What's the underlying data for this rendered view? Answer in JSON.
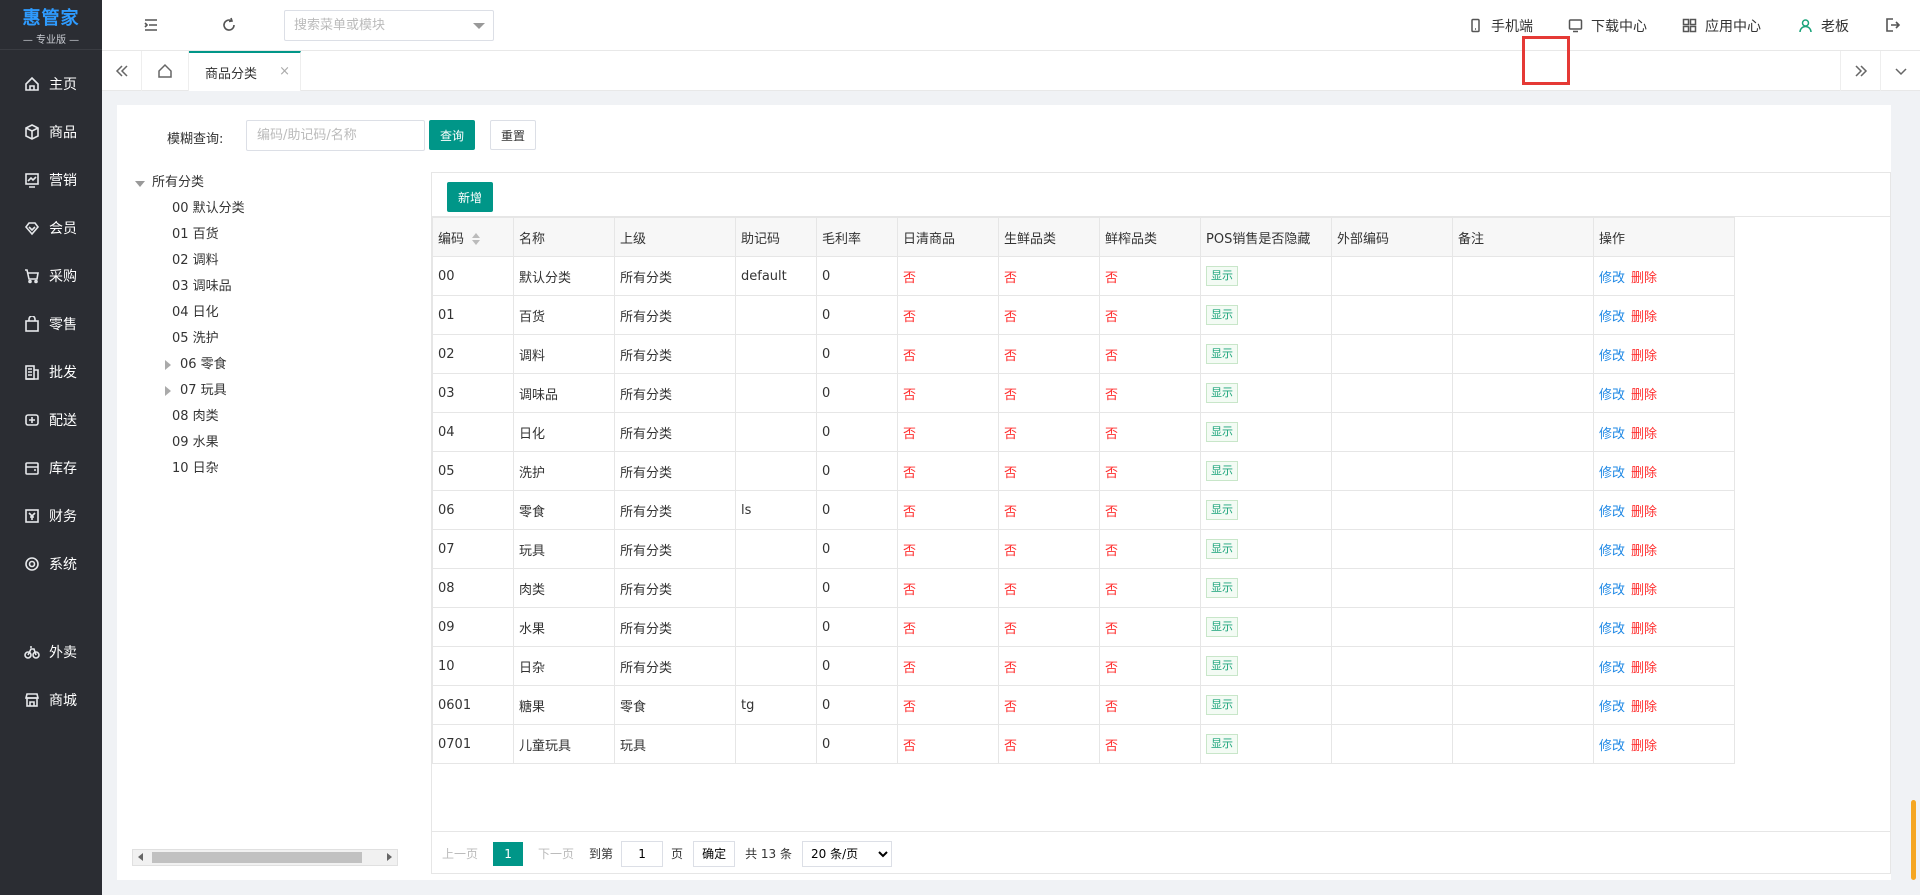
{
  "brand": {
    "name": "惠管家",
    "edition": "— 专业版 —"
  },
  "sidebar": {
    "items": [
      {
        "label": "主页",
        "icon": "home-icon"
      },
      {
        "label": "商品",
        "icon": "cube-icon"
      },
      {
        "label": "营销",
        "icon": "chart-icon"
      },
      {
        "label": "会员",
        "icon": "diamond-icon"
      },
      {
        "label": "采购",
        "icon": "cart-icon"
      },
      {
        "label": "零售",
        "icon": "bag-icon"
      },
      {
        "label": "批发",
        "icon": "building-icon"
      },
      {
        "label": "配送",
        "icon": "truck-icon"
      },
      {
        "label": "库存",
        "icon": "wallet-icon"
      },
      {
        "label": "财务",
        "icon": "money-icon"
      },
      {
        "label": "系统",
        "icon": "settings-icon"
      }
    ],
    "extra": [
      {
        "label": "外卖",
        "icon": "bike-icon"
      },
      {
        "label": "商城",
        "icon": "shop-icon"
      }
    ]
  },
  "header": {
    "search_placeholder": "搜索菜单或模块",
    "links": {
      "mobile": "手机端",
      "download": "下载中心",
      "apps": "应用中心",
      "user": "老板"
    }
  },
  "tabs": {
    "active": "商品分类",
    "close": "×"
  },
  "filter": {
    "label": "模糊查询:",
    "placeholder": "编码/助记码/名称",
    "query": "查询",
    "reset": "重置"
  },
  "tree": {
    "root": "所有分类",
    "nodes": [
      "00 默认分类",
      "01 百货",
      "02 调料",
      "03 调味品",
      "04 日化",
      "05 洗护",
      "06 零食",
      "07 玩具",
      "08 肉类",
      "09 水果",
      "10 日杂"
    ]
  },
  "toolbar": {
    "add": "新增"
  },
  "table": {
    "headers": [
      "编码",
      "名称",
      "上级",
      "助记码",
      "毛利率",
      "日清商品",
      "生鲜品类",
      "鲜榨品类",
      "POS销售是否隐藏",
      "外部编码",
      "备注",
      "操作"
    ],
    "edit": "修改",
    "delete": "删除",
    "rows": [
      {
        "code": "00",
        "name": "默认分类",
        "parent": "所有分类",
        "mnemonic": "default",
        "margin": "0",
        "daily": "否",
        "fresh": "否",
        "juice": "否",
        "pos": "显示",
        "ext": "",
        "remark": ""
      },
      {
        "code": "01",
        "name": "百货",
        "parent": "所有分类",
        "mnemonic": "",
        "margin": "0",
        "daily": "否",
        "fresh": "否",
        "juice": "否",
        "pos": "显示",
        "ext": "",
        "remark": ""
      },
      {
        "code": "02",
        "name": "调料",
        "parent": "所有分类",
        "mnemonic": "",
        "margin": "0",
        "daily": "否",
        "fresh": "否",
        "juice": "否",
        "pos": "显示",
        "ext": "",
        "remark": ""
      },
      {
        "code": "03",
        "name": "调味品",
        "parent": "所有分类",
        "mnemonic": "",
        "margin": "0",
        "daily": "否",
        "fresh": "否",
        "juice": "否",
        "pos": "显示",
        "ext": "",
        "remark": ""
      },
      {
        "code": "04",
        "name": "日化",
        "parent": "所有分类",
        "mnemonic": "",
        "margin": "0",
        "daily": "否",
        "fresh": "否",
        "juice": "否",
        "pos": "显示",
        "ext": "",
        "remark": ""
      },
      {
        "code": "05",
        "name": "洗护",
        "parent": "所有分类",
        "mnemonic": "",
        "margin": "0",
        "daily": "否",
        "fresh": "否",
        "juice": "否",
        "pos": "显示",
        "ext": "",
        "remark": ""
      },
      {
        "code": "06",
        "name": "零食",
        "parent": "所有分类",
        "mnemonic": "ls",
        "margin": "0",
        "daily": "否",
        "fresh": "否",
        "juice": "否",
        "pos": "显示",
        "ext": "",
        "remark": ""
      },
      {
        "code": "07",
        "name": "玩具",
        "parent": "所有分类",
        "mnemonic": "",
        "margin": "0",
        "daily": "否",
        "fresh": "否",
        "juice": "否",
        "pos": "显示",
        "ext": "",
        "remark": ""
      },
      {
        "code": "08",
        "name": "肉类",
        "parent": "所有分类",
        "mnemonic": "",
        "margin": "0",
        "daily": "否",
        "fresh": "否",
        "juice": "否",
        "pos": "显示",
        "ext": "",
        "remark": ""
      },
      {
        "code": "09",
        "name": "水果",
        "parent": "所有分类",
        "mnemonic": "",
        "margin": "0",
        "daily": "否",
        "fresh": "否",
        "juice": "否",
        "pos": "显示",
        "ext": "",
        "remark": ""
      },
      {
        "code": "10",
        "name": "日杂",
        "parent": "所有分类",
        "mnemonic": "",
        "margin": "0",
        "daily": "否",
        "fresh": "否",
        "juice": "否",
        "pos": "显示",
        "ext": "",
        "remark": ""
      },
      {
        "code": "0601",
        "name": "糖果",
        "parent": "零食",
        "mnemonic": "tg",
        "margin": "0",
        "daily": "否",
        "fresh": "否",
        "juice": "否",
        "pos": "显示",
        "ext": "",
        "remark": ""
      },
      {
        "code": "0701",
        "name": "儿童玩具",
        "parent": "玩具",
        "mnemonic": "",
        "margin": "0",
        "daily": "否",
        "fresh": "否",
        "juice": "否",
        "pos": "显示",
        "ext": "",
        "remark": ""
      }
    ]
  },
  "pagination": {
    "prev": "上一页",
    "current": "1",
    "next": "下一页",
    "goto": "到第",
    "page_value": "1",
    "page_unit": "页",
    "confirm": "确定",
    "total": "共 13 条",
    "size_selected": "20 条/页"
  },
  "colors": {
    "primary": "#009688",
    "sidebar": "#2b2d33",
    "danger": "#ff2e2e",
    "link": "#1e88e5",
    "highlight": "#e53935"
  }
}
